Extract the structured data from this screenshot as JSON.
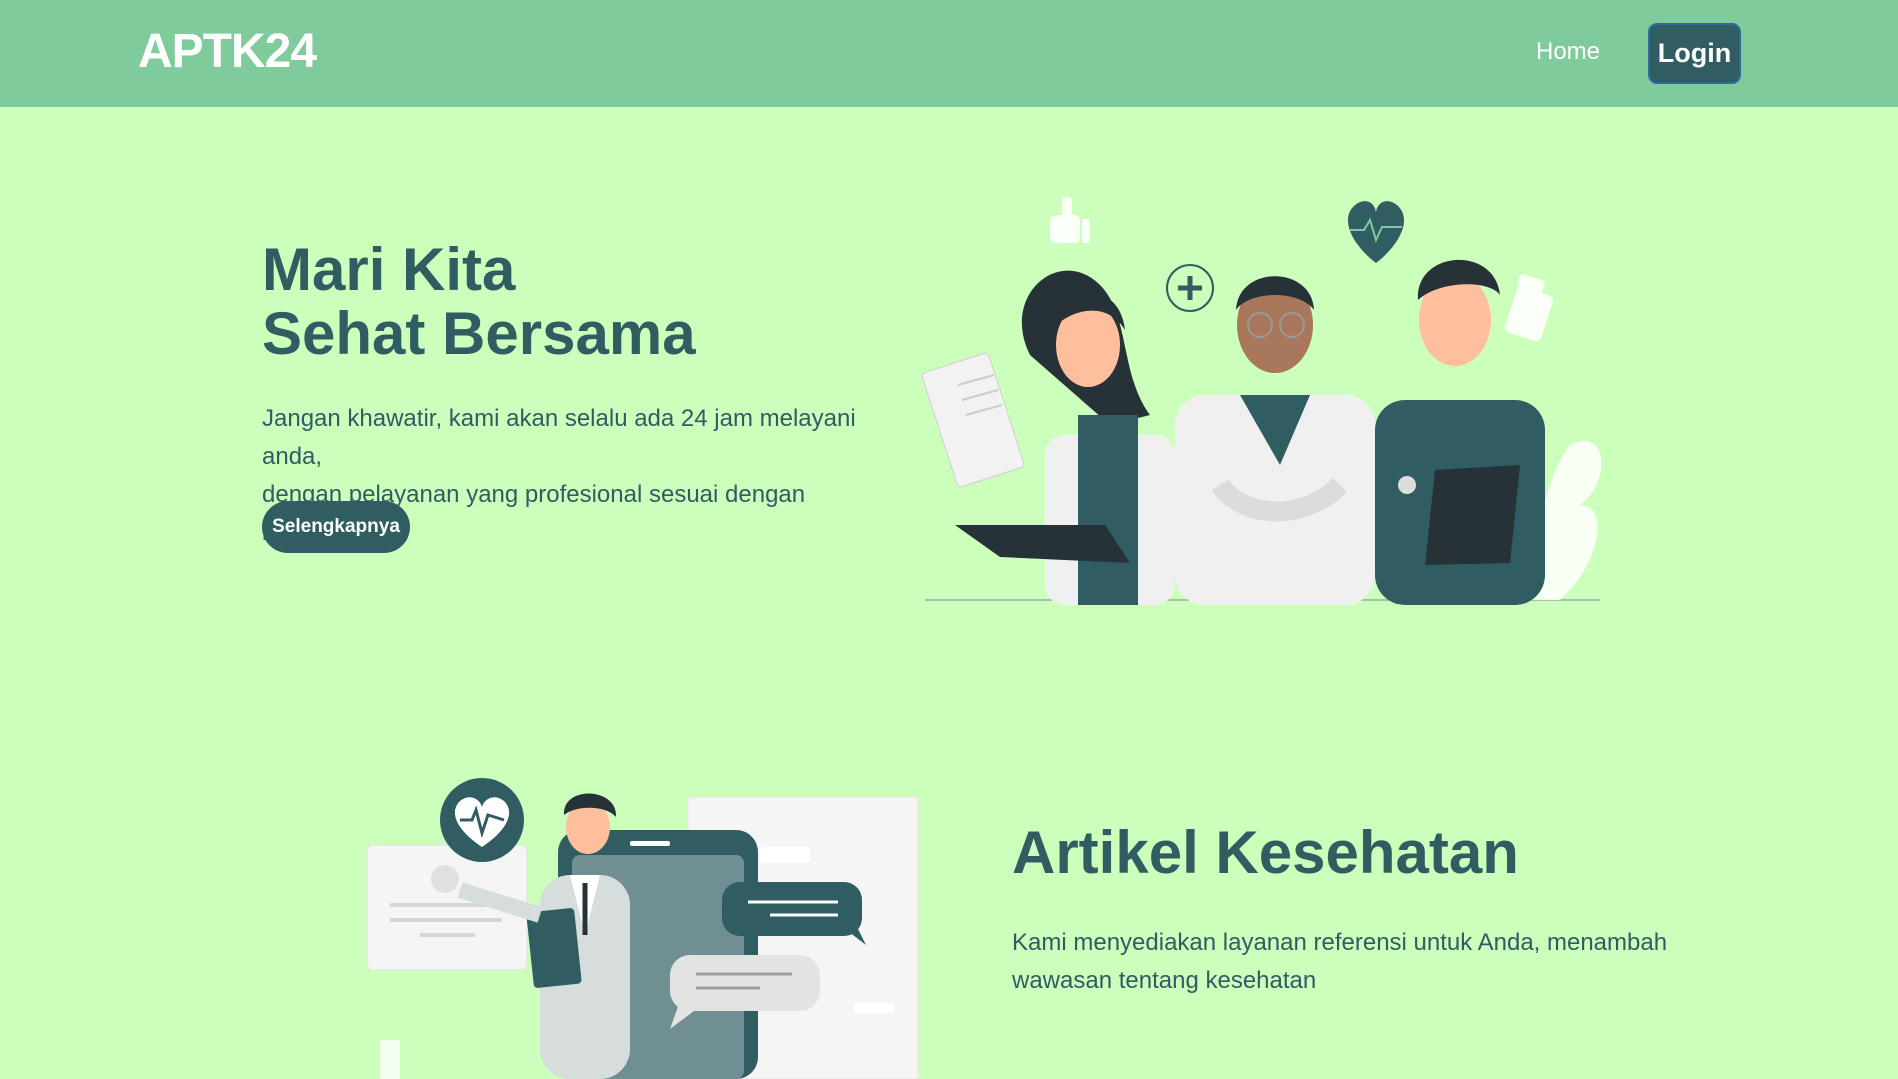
{
  "navbar": {
    "brand": "APTK24",
    "links": {
      "home": "Home",
      "login": "Login"
    }
  },
  "hero": {
    "title_line1": "Mari Kita",
    "title_line2": "Sehat Bersama",
    "text_line1": "Jangan khawatir, kami akan selalu ada 24 jam melayani anda,",
    "text_line2": "dengan pelayanan yang profesional sesuai dengan bidangnya",
    "button": "Selengkapnya"
  },
  "article": {
    "title": "Artikel Kesehatan",
    "text_line1": "Kami menyediakan layanan referensi untuk Anda, menambah",
    "text_line2": "wawasan tentang kesehatan"
  },
  "colors": {
    "navbar_bg": "#7fcb9b",
    "page_bg": "#ccffbb",
    "primary_dark": "#2f5d62"
  }
}
